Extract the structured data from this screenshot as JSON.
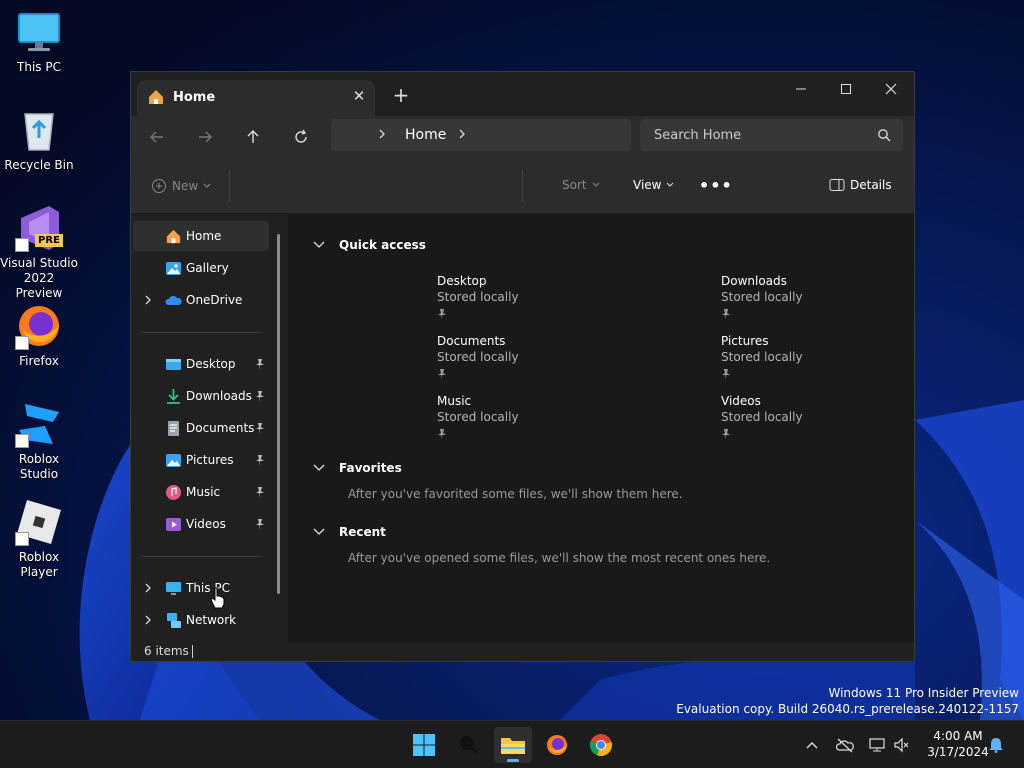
{
  "desktop": {
    "icons": [
      {
        "label": "This PC",
        "icon": "monitor-icon"
      },
      {
        "label": "Recycle Bin",
        "icon": "recycle-bin-icon"
      },
      {
        "label": "Visual Studio 2022 Preview",
        "icon": "visual-studio-icon",
        "badge": "PRE"
      },
      {
        "label": "Firefox",
        "icon": "firefox-icon"
      },
      {
        "label": "Roblox Studio",
        "icon": "roblox-studio-icon"
      },
      {
        "label": "Roblox Player",
        "icon": "roblox-player-icon"
      }
    ],
    "watermark": {
      "line1": "Windows 11 Pro Insider Preview",
      "line2": "Evaluation copy. Build 26040.rs_prerelease.240122-1157"
    }
  },
  "explorer": {
    "tab": {
      "label": "Home",
      "icon": "home-icon"
    },
    "address": {
      "crumb": "Home"
    },
    "search": {
      "placeholder": "Search Home"
    },
    "commands": {
      "new": "New",
      "sort": "Sort",
      "view": "View",
      "details": "Details"
    },
    "sidebar": {
      "top": [
        {
          "label": "Home",
          "icon": "home-icon",
          "selected": true
        },
        {
          "label": "Gallery",
          "icon": "gallery-icon"
        },
        {
          "label": "OneDrive",
          "icon": "cloud-icon",
          "expandable": true
        }
      ],
      "pinned": [
        {
          "label": "Desktop",
          "icon": "desktop-folder-icon"
        },
        {
          "label": "Downloads",
          "icon": "downloads-icon"
        },
        {
          "label": "Documents",
          "icon": "documents-icon"
        },
        {
          "label": "Pictures",
          "icon": "pictures-icon"
        },
        {
          "label": "Music",
          "icon": "music-icon"
        },
        {
          "label": "Videos",
          "icon": "videos-icon"
        }
      ],
      "bottom": [
        {
          "label": "This PC",
          "icon": "monitor-icon",
          "expandable": true
        },
        {
          "label": "Network",
          "icon": "network-icon",
          "expandable": true
        }
      ]
    },
    "quick_access": {
      "title": "Quick access",
      "items": [
        {
          "name": "Desktop",
          "sub": "Stored locally"
        },
        {
          "name": "Downloads",
          "sub": "Stored locally"
        },
        {
          "name": "Documents",
          "sub": "Stored locally"
        },
        {
          "name": "Pictures",
          "sub": "Stored locally"
        },
        {
          "name": "Music",
          "sub": "Stored locally"
        },
        {
          "name": "Videos",
          "sub": "Stored locally"
        }
      ]
    },
    "favorites": {
      "title": "Favorites",
      "message": "After you've favorited some files, we'll show them here."
    },
    "recent": {
      "title": "Recent",
      "message": "After you've opened some files, we'll show the most recent ones here."
    },
    "status": {
      "count": "6 items"
    }
  },
  "taskbar": {
    "apps": [
      "windows-start-icon",
      "search-icon",
      "file-explorer-icon",
      "firefox-icon",
      "chrome-icon"
    ],
    "tray": [
      "chevron-up-icon",
      "cloud-off-icon",
      "network-icon",
      "volume-muted-icon"
    ],
    "time": "4:00 AM",
    "date": "3/17/2024",
    "accent": "#5fb2f2"
  }
}
